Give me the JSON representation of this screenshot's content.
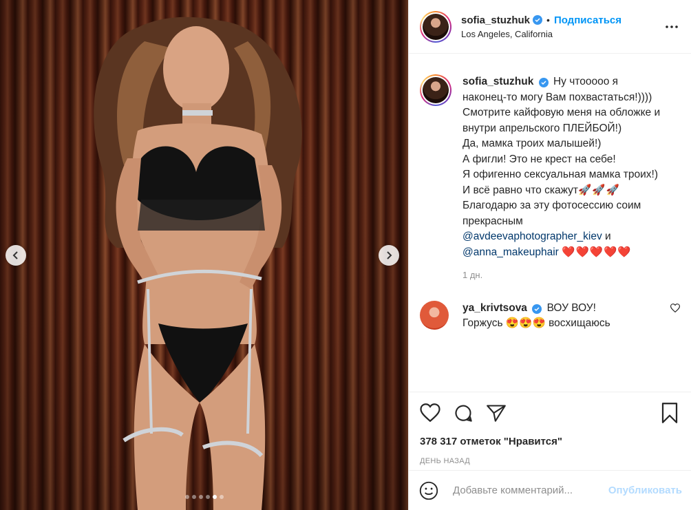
{
  "post": {
    "author": {
      "username": "sofia_stuzhuk",
      "verified": true,
      "follow_label": "Подписаться",
      "location": "Los Angeles, California",
      "avatar": "avatar-photo"
    },
    "menu_icon": "more-horizontal-icon",
    "media": {
      "prev_icon": "chevron-left-icon",
      "next_icon": "chevron-right-icon",
      "slide_count": 6,
      "active_slide": 5
    },
    "caption": {
      "username": "sofia_stuzhuk",
      "lines": [
        "Ну чтооооо я наконец-то могу Вам похвастаться!))))",
        "Смотрите кайфовую меня на обложке и внутри апрельского ПЛЕЙБОЙ!)",
        "Да, мамка троих малышей!)",
        "А фигли! Это не крест на себе!",
        "Я офигенно сексуальная мамка троих!)",
        "И всё равно что скажут",
        "Благодарю за эту фотосессию соим прекрасным"
      ],
      "rockets": "🚀🚀🚀",
      "mention_1": "@avdeevaphotographer_kiev",
      "conjunction": "и",
      "mention_2": "@anna_makeuphair",
      "hearts": "❤️❤️❤️❤️❤️",
      "time": "1 дн."
    },
    "comment": {
      "username": "ya_krivtsova",
      "verified": true,
      "text_1": "ВОУ ВОУ!",
      "text_2": "Горжусь",
      "emojis": "😍😍😍",
      "text_3": "восхищаюсь",
      "like_icon": "heart-outline-icon"
    },
    "actions": {
      "like_icon": "heart-outline-icon",
      "comment_icon": "comment-bubble-icon",
      "share_icon": "paper-plane-icon",
      "save_icon": "bookmark-icon"
    },
    "likes_text": "378 317 отметок \"Нравится\"",
    "date_text": "ДЕНЬ НАЗАД",
    "add_comment": {
      "emoji_icon": "smiley-icon",
      "placeholder": "Добавьте комментарий...",
      "post_label": "Опубликовать"
    },
    "colors": {
      "accent": "#0095f6",
      "post_disabled": "#b3dbff",
      "verified": "#3897f0",
      "heart": "#ed4956"
    }
  }
}
